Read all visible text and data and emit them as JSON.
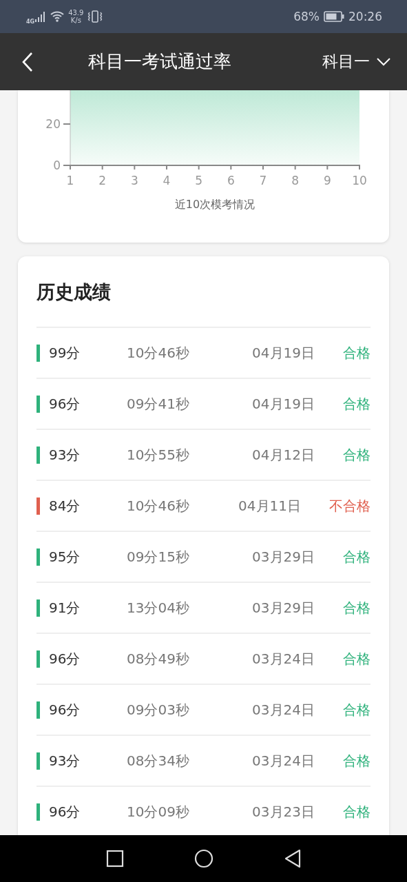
{
  "status_bar": {
    "network": "4G",
    "speed_value": "43.9",
    "speed_unit": "K/s",
    "battery": "68%",
    "time": "20:26"
  },
  "header": {
    "title": "科目一考试通过率",
    "subject": "科目一"
  },
  "chart": {
    "y_ticks": [
      "20",
      "0"
    ],
    "x_ticks": [
      "1",
      "2",
      "3",
      "4",
      "5",
      "6",
      "7",
      "8",
      "9",
      "10"
    ],
    "caption": "近10次模考情况"
  },
  "history": {
    "title": "历史成绩",
    "rows": [
      {
        "score": "99分",
        "duration": "10分46秒",
        "date": "04月19日",
        "result": "合格",
        "passed": true
      },
      {
        "score": "96分",
        "duration": "09分41秒",
        "date": "04月19日",
        "result": "合格",
        "passed": true
      },
      {
        "score": "93分",
        "duration": "10分55秒",
        "date": "04月12日",
        "result": "合格",
        "passed": true
      },
      {
        "score": "84分",
        "duration": "10分46秒",
        "date": "04月11日",
        "result": "不合格",
        "passed": false
      },
      {
        "score": "95分",
        "duration": "09分15秒",
        "date": "03月29日",
        "result": "合格",
        "passed": true
      },
      {
        "score": "91分",
        "duration": "13分04秒",
        "date": "03月29日",
        "result": "合格",
        "passed": true
      },
      {
        "score": "96分",
        "duration": "08分49秒",
        "date": "03月24日",
        "result": "合格",
        "passed": true
      },
      {
        "score": "96分",
        "duration": "09分03秒",
        "date": "03月24日",
        "result": "合格",
        "passed": true
      },
      {
        "score": "93分",
        "duration": "08分34秒",
        "date": "03月24日",
        "result": "合格",
        "passed": true
      },
      {
        "score": "96分",
        "duration": "10分09秒",
        "date": "03月23日",
        "result": "合格",
        "passed": true
      }
    ]
  }
}
